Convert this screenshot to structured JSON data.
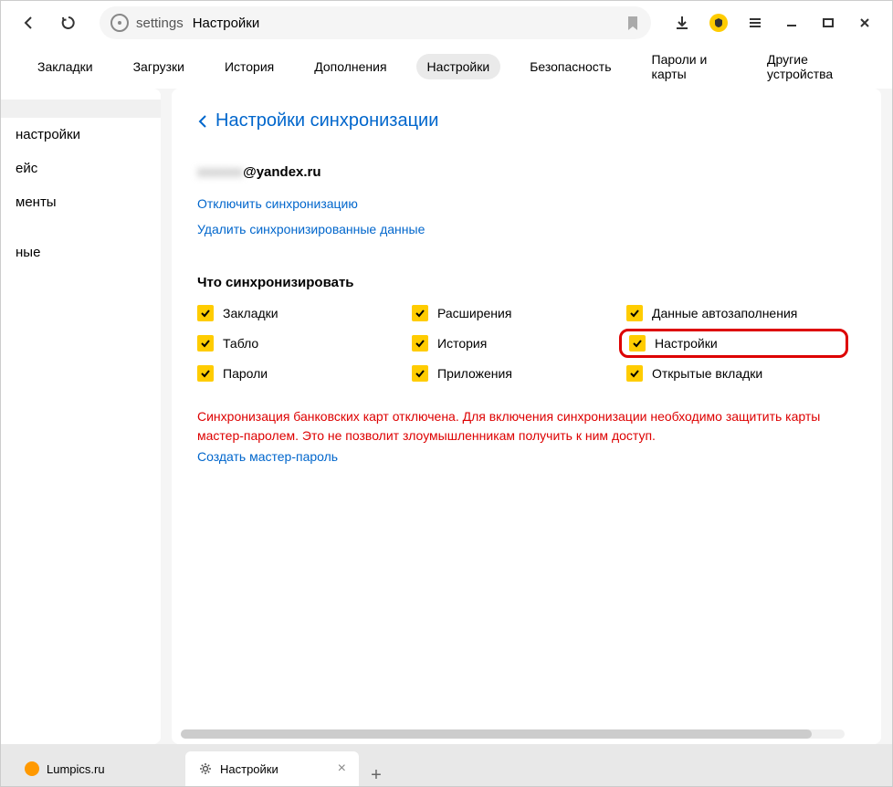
{
  "toolbar": {
    "address_label": "settings",
    "address_title": "Настройки"
  },
  "nav": {
    "items": [
      {
        "label": "Закладки"
      },
      {
        "label": "Загрузки"
      },
      {
        "label": "История"
      },
      {
        "label": "Дополнения"
      },
      {
        "label": "Настройки"
      },
      {
        "label": "Безопасность"
      },
      {
        "label": "Пароли и карты"
      },
      {
        "label": "Другие устройства"
      }
    ],
    "active_index": 4
  },
  "sidebar": {
    "items": [
      {
        "label": " "
      },
      {
        "label": "настройки"
      },
      {
        "label": "ейс"
      },
      {
        "label": "менты"
      },
      {
        "label": "ные"
      }
    ]
  },
  "page": {
    "title": "Настройки синхронизации",
    "account": {
      "email_masked": "xxxxxx",
      "email_domain": "@yandex.ru",
      "disable_link": "Отключить синхронизацию",
      "delete_link": "Удалить синхронизированные данные"
    },
    "sync": {
      "heading": "Что синхронизировать",
      "items": [
        {
          "label": "Закладки",
          "checked": true
        },
        {
          "label": "Расширения",
          "checked": true
        },
        {
          "label": "Данные автозаполнения",
          "checked": true
        },
        {
          "label": "Табло",
          "checked": true
        },
        {
          "label": "История",
          "checked": true
        },
        {
          "label": "Настройки",
          "checked": true,
          "highlighted": true
        },
        {
          "label": "Пароли",
          "checked": true
        },
        {
          "label": "Приложения",
          "checked": true
        },
        {
          "label": "Открытые вкладки",
          "checked": true
        }
      ]
    },
    "warning": "Синхронизация банковских карт отключена. Для включения синхронизации необходимо защитить карты мастер-паролем. Это не позволит злоумышленникам получить к ним доступ.",
    "create_master_link": "Создать мастер-пароль"
  },
  "tabs": [
    {
      "label": "Lumpics.ru",
      "icon": "lumpics"
    },
    {
      "label": "Настройки",
      "icon": "gear",
      "active": true
    }
  ]
}
